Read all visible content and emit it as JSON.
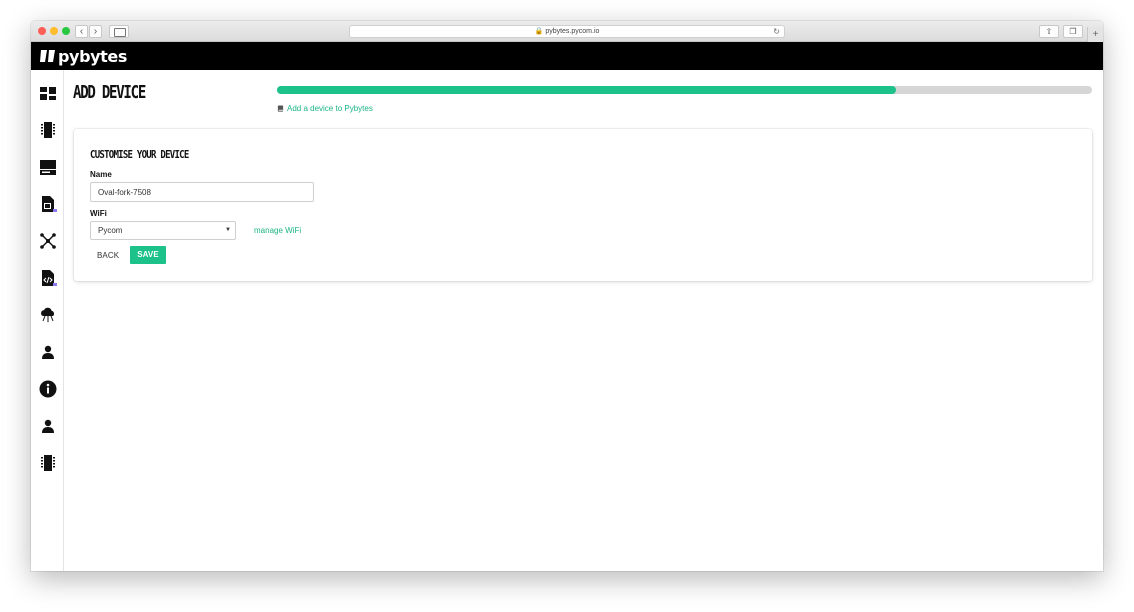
{
  "browser": {
    "url": "pybytes.pycom.io",
    "back_glyph": "‹",
    "forward_glyph": "›",
    "new_tab_glyph": "+"
  },
  "app": {
    "brand": "pybytes",
    "header_color": "#000000",
    "accent_color": "#1dc28a"
  },
  "sidebar": {
    "items": [
      {
        "name": "dashboard-icon"
      },
      {
        "name": "devices-icon"
      },
      {
        "name": "projects-icon"
      },
      {
        "name": "sim-icon",
        "badge": "beta"
      },
      {
        "name": "integrations-icon"
      },
      {
        "name": "firmware-icon",
        "badge": "beta"
      },
      {
        "name": "cloud-icon"
      },
      {
        "name": "user-icon"
      },
      {
        "name": "info-icon"
      },
      {
        "name": "account-icon"
      },
      {
        "name": "device-chip-icon"
      }
    ]
  },
  "page": {
    "title": "ADD DEVICE",
    "progress": 0.76,
    "doc_link": "Add a device to Pybytes"
  },
  "card": {
    "title": "CUSTOMISE YOUR DEVICE",
    "name_label": "Name",
    "name_value": "Oval-fork-7508",
    "wifi_label": "WiFi",
    "wifi_selected": "Pycom",
    "manage_wifi": "manage WiFi",
    "back_label": "BACK",
    "save_label": "SAVE"
  }
}
